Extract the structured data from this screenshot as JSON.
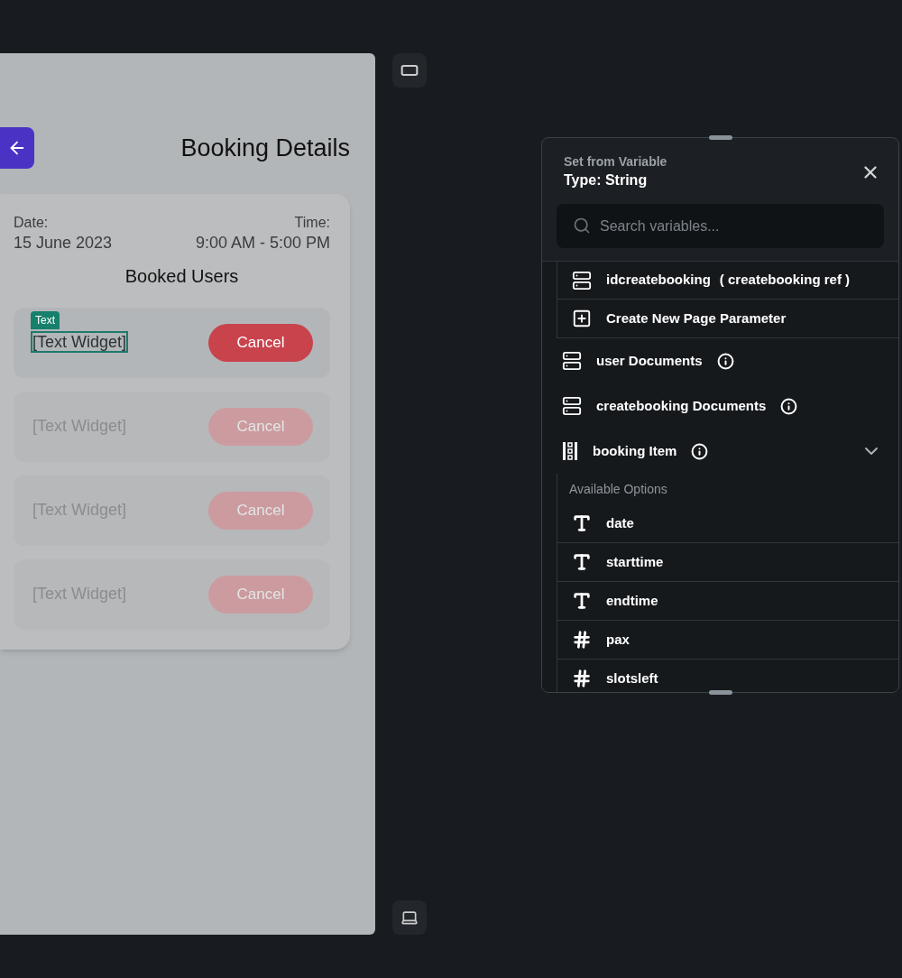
{
  "phone": {
    "title": "Booking Details",
    "date_label": "Date:",
    "date": "15 June 2023",
    "time_label": "Time:",
    "time": "9:00 AM - 5:00 PM",
    "section_title": "Booked Users",
    "rows": [
      {
        "text": "[Text Widget]",
        "button": "Cancel",
        "selected": true,
        "badge": "Text"
      },
      {
        "text": "[Text Widget]",
        "button": "Cancel",
        "selected": false
      },
      {
        "text": "[Text Widget]",
        "button": "Cancel",
        "selected": false
      },
      {
        "text": "[Text Widget]",
        "button": "Cancel",
        "selected": false
      }
    ]
  },
  "panel": {
    "subtitle": "Set from Variable",
    "title": "Type: String",
    "search": {
      "placeholder": "Search variables..."
    },
    "items": [
      {
        "kind": "group",
        "children": [
          {
            "kind": "document",
            "label": "idcreatebooking",
            "note": "( createbooking ref )"
          },
          {
            "kind": "create",
            "label": "Create New Page Parameter"
          }
        ]
      },
      {
        "kind": "collection",
        "label": "user Documents",
        "info": true
      },
      {
        "kind": "collection",
        "label": "createbooking Documents",
        "info": true
      },
      {
        "kind": "list",
        "label": "booking Item",
        "info": true,
        "expanded": true,
        "options_label": "Available Options",
        "children": [
          {
            "kind": "text",
            "label": "date"
          },
          {
            "kind": "text",
            "label": "starttime"
          },
          {
            "kind": "text",
            "label": "endtime"
          },
          {
            "kind": "number",
            "label": "pax"
          },
          {
            "kind": "number",
            "label": "slotsleft"
          }
        ]
      }
    ]
  }
}
